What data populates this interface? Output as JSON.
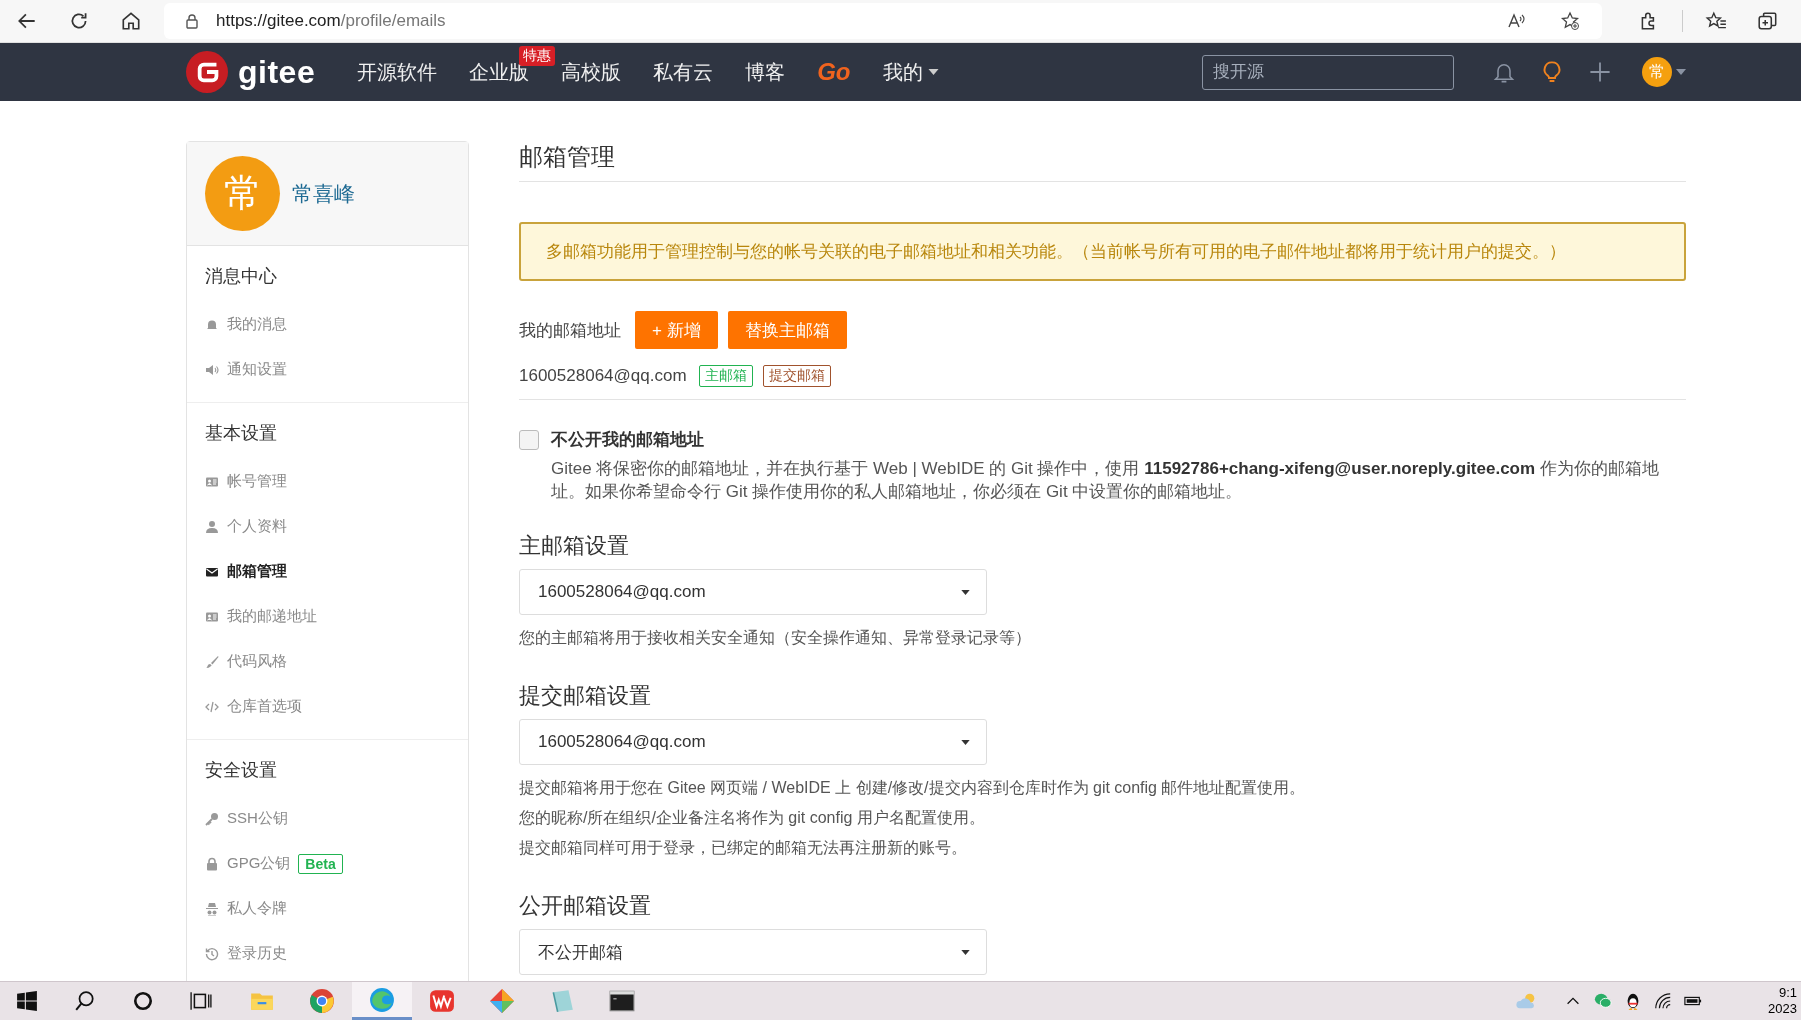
{
  "browser": {
    "url_host": "https://gitee.com",
    "url_path": "/profile/emails"
  },
  "nav": {
    "logo": "gitee",
    "items": [
      {
        "label": "开源软件",
        "kind": "text"
      },
      {
        "label": "企业版",
        "kind": "text",
        "badge": "特惠"
      },
      {
        "label": "高校版",
        "kind": "text"
      },
      {
        "label": "私有云",
        "kind": "text"
      },
      {
        "label": "博客",
        "kind": "text"
      },
      {
        "label": "Go",
        "kind": "brand"
      },
      {
        "label": "我的",
        "kind": "dropdown"
      }
    ],
    "search": {
      "placeholder": "搜开源"
    },
    "avatar": "常"
  },
  "sidebar": {
    "user": {
      "avatar": "常",
      "name": "常喜峰"
    },
    "sections": [
      {
        "title": "消息中心",
        "items": [
          {
            "label": "我的消息",
            "selected": false
          },
          {
            "label": "通知设置",
            "selected": false
          }
        ]
      },
      {
        "title": "基本设置",
        "items": [
          {
            "label": "帐号管理",
            "selected": false
          },
          {
            "label": "个人资料",
            "selected": false
          },
          {
            "label": "邮箱管理",
            "selected": true
          },
          {
            "label": "我的邮递地址",
            "selected": false
          },
          {
            "label": "代码风格",
            "selected": false
          },
          {
            "label": "仓库首选项",
            "selected": false
          }
        ]
      },
      {
        "title": "安全设置",
        "items": [
          {
            "label": "SSH公钥",
            "selected": false
          },
          {
            "label": "GPG公钥",
            "selected": false,
            "badge": "Beta"
          },
          {
            "label": "私人令牌",
            "selected": false
          },
          {
            "label": "登录历史",
            "selected": false
          }
        ]
      }
    ]
  },
  "main": {
    "title": "邮箱管理",
    "alert": "多邮箱功能用于管理控制与您的帐号关联的电子邮箱地址和相关功能。（当前帐号所有可用的电子邮件地址都将用于统计用户的提交。）",
    "email_list": {
      "label": "我的邮箱地址",
      "buttons": [
        "+ 新增",
        "替换主邮箱"
      ],
      "emails": [
        {
          "address": "1600528064@qq.com",
          "tags": [
            {
              "label": "主邮箱",
              "kind": "primary"
            },
            {
              "label": "提交邮箱",
              "kind": "commit"
            }
          ]
        }
      ]
    },
    "privacy": {
      "label": "不公开我的邮箱地址",
      "checked": false,
      "description": "Gitee 将保密你的邮箱地址，并在执行基于 Web | WebIDE 的 Git 操作中，使用 **11592786+chang-xifeng@user.noreply.gitee.com** 作为你的邮箱地址。如果你希望命令行 Git 操作使用你的私人邮箱地址，你必须在 Git 中设置你的邮箱地址。"
    },
    "settings": [
      {
        "title": "主邮箱设置",
        "value": "1600528064@qq.com",
        "help": [
          "您的主邮箱将用于接收相关安全通知（安全操作通知、异常登录记录等）"
        ]
      },
      {
        "title": "提交邮箱设置",
        "value": "1600528064@qq.com",
        "help": [
          "提交邮箱将用于您在 Gitee 网页端 / WebIDE 上 创建/修改/提交内容到仓库时作为 git config 邮件地址配置使用。",
          "您的昵称/所在组织/企业备注名将作为 git config 用户名配置使用。",
          "提交邮箱同样可用于登录，已绑定的邮箱无法再注册新的账号。"
        ]
      },
      {
        "title": "公开邮箱设置",
        "value": "不公开邮箱"
      }
    ]
  },
  "taskbar": {
    "apps": [
      {
        "selected": false
      },
      {
        "selected": false
      },
      {
        "selected": true
      },
      {
        "selected": false
      },
      {
        "selected": false
      },
      {
        "selected": false
      },
      {
        "selected": false
      }
    ],
    "clock": [
      "9:1",
      "2023"
    ]
  }
}
